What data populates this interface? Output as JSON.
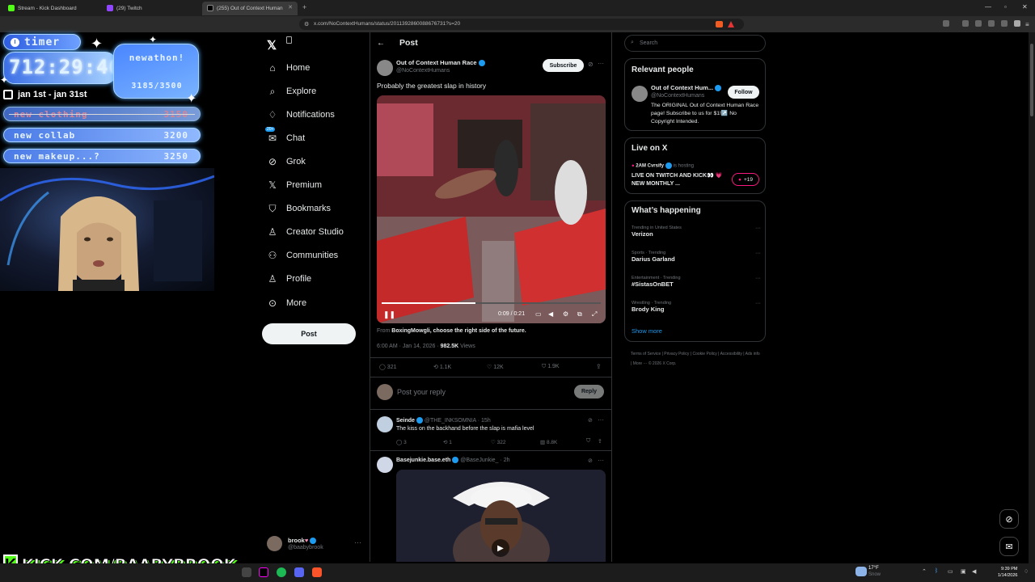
{
  "browser": {
    "tabs": [
      {
        "label": "Stream - Kick Dashboard"
      },
      {
        "label": "(29) Twitch"
      },
      {
        "label": "(255) Out of Context Human"
      }
    ],
    "url": "x.com/NoContextHumans/status/2011392860088676731?s=20"
  },
  "overlay": {
    "timer_label": "timer",
    "timer_value": "712:29:46",
    "newathon_label": "newathon!",
    "newathon_count": "3185/3500",
    "date_range": "jan 1st - jan 31st",
    "goals": [
      {
        "label": "new clothing",
        "value": "3150",
        "done": true
      },
      {
        "label": "new collab",
        "value": "3200",
        "done": false
      },
      {
        "label": "new makeup...?",
        "value": "3250",
        "done": false
      }
    ],
    "kick_handle": "KICK.COM/BAABYBROOK"
  },
  "sidebar": {
    "items": [
      {
        "label": "Home",
        "icon": "home-icon"
      },
      {
        "label": "Explore",
        "icon": "search-icon"
      },
      {
        "label": "Notifications",
        "icon": "bell-icon"
      },
      {
        "label": "Chat",
        "icon": "chat-icon",
        "badge": "20+"
      },
      {
        "label": "Grok",
        "icon": "grok-icon"
      },
      {
        "label": "Premium",
        "icon": "x-logo-icon"
      },
      {
        "label": "Bookmarks",
        "icon": "bookmark-icon"
      },
      {
        "label": "Creator Studio",
        "icon": "creator-icon"
      },
      {
        "label": "Communities",
        "icon": "communities-icon"
      },
      {
        "label": "Profile",
        "icon": "person-icon"
      },
      {
        "label": "More",
        "icon": "more-circle-icon"
      }
    ],
    "post_button": "Post",
    "account": {
      "name": "brook",
      "handle": "@baabybrook"
    }
  },
  "post": {
    "header_title": "Post",
    "author_name": "Out of Context Human Race",
    "author_handle": "@NoContextHumans",
    "subscribe_label": "Subscribe",
    "text": "Probably the greatest slap in history",
    "video_time": "0:09 / 0:21",
    "from_prefix": "From",
    "from_source": "BoxingMowgli, choose the right side of the future.",
    "timestamp": "6:00 AM · Jan 14, 2026",
    "views_count": "982.5K",
    "views_label": "Views",
    "stats": {
      "replies": "321",
      "reposts": "1.1K",
      "likes": "12K",
      "bookmarks": "1.9K"
    },
    "reply_placeholder": "Post your reply",
    "reply_button": "Reply"
  },
  "replies": [
    {
      "name": "Seinde",
      "handle": "@THE_INKSOMNIA",
      "time": "· 15h",
      "text": "The kiss on the backhand before the slap is mafia level",
      "stats": {
        "replies": "3",
        "reposts": "1",
        "likes": "322",
        "views": "8.8K"
      }
    },
    {
      "name": "Basejunkie.base.eth",
      "handle": "@BaseJunkie_",
      "time": "· 2h"
    }
  ],
  "right": {
    "search_placeholder": "Search",
    "relevant_title": "Relevant people",
    "relevant_person": {
      "name": "Out of Context Hum...",
      "handle": "@NoContextHumans",
      "bio": "The ORIGINAL Out of Context Human Race page! Subscribe to us for $1!↗️ No Copyright Intended.",
      "follow_label": "Follow"
    },
    "live_title": "Live on X",
    "live_host": "2AM Cvrsify",
    "live_hosting": "is hosting",
    "live_text": "LIVE ON TWITCH AND KICK👀 💗NEW MONTHLY ...",
    "live_count": "+19",
    "happening_title": "What’s happening",
    "trends": [
      {
        "category": "Trending in United States",
        "name": "Verizon"
      },
      {
        "category": "Sports · Trending",
        "name": "Darius Garland"
      },
      {
        "category": "Entertainment · Trending",
        "name": "#SistasOnBET"
      },
      {
        "category": "Wrestling · Trending",
        "name": "Brody King"
      }
    ],
    "show_more": "Show more",
    "footer": "Terms of Service  |  Privacy Policy  |  Cookie Policy  |  Accessibility  |  Ads info  |  More ···  © 2026 X Corp."
  },
  "taskbar": {
    "weather_temp": "17°F",
    "weather_desc": "Snow",
    "time": "9:39 PM",
    "date": "1/14/2026"
  },
  "colors": {
    "accent": "#1d9bf0",
    "kick": "#53fc18",
    "overlay_blue": "#4a7ae6"
  }
}
